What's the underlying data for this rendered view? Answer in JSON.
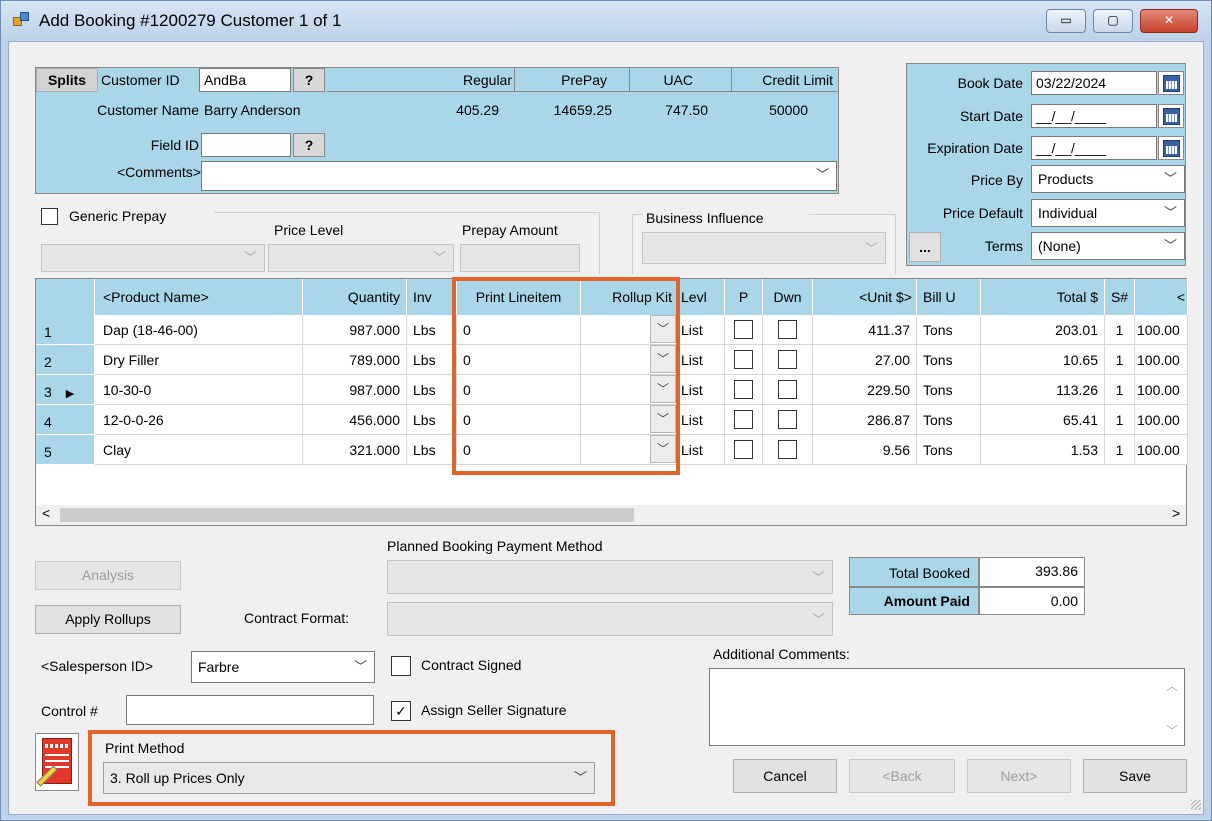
{
  "window": {
    "title": "Add Booking #1200279 Customer 1 of 1",
    "controls": {
      "minimize": "▭",
      "maximize": "▢",
      "close": "✕"
    }
  },
  "customer": {
    "splits_label": "Splits",
    "customer_id_label": "Customer ID",
    "customer_id_value": "AndBa",
    "lookup_label": "?",
    "customer_name_label": "Customer Name",
    "customer_name_value": "Barry Anderson",
    "field_id_label": "Field ID",
    "field_id_value": "",
    "comments_label": "<Comments>",
    "comments_value": "",
    "balances": [
      {
        "header": "Regular",
        "value": "405.29"
      },
      {
        "header": "PrePay",
        "value": "14659.25"
      },
      {
        "header": "UAC",
        "value": "747.50"
      },
      {
        "header": "Credit Limit",
        "value": "50000"
      }
    ]
  },
  "dates": {
    "book_date_label": "Book Date",
    "book_date_value": "03/22/2024",
    "start_date_label": "Start Date",
    "start_date_value": "__/__/____",
    "expiration_date_label": "Expiration Date",
    "expiration_date_value": "__/__/____",
    "price_by_label": "Price By",
    "price_by_value": "Products",
    "price_default_label": "Price Default",
    "price_default_value": "Individual",
    "terms_button": "...",
    "terms_label": "Terms",
    "terms_value": "(None)"
  },
  "prepay": {
    "generic_prepay_label": "Generic Prepay",
    "price_level_label": "Price Level",
    "prepay_amount_label": "Prepay Amount",
    "business_influence_label": "Business Influence"
  },
  "grid": {
    "headers": {
      "product": "<Product Name>",
      "quantity": "Quantity",
      "inv": "Inv",
      "print_lineitem": "Print Lineitem",
      "rollup_kit": "Rollup Kit",
      "levl": "Levl",
      "p": "P",
      "dwn": "Dwn",
      "unit_price": "<Unit $>",
      "bill_u": "Bill U",
      "total": "Total $",
      "s_num": "S#",
      "more": "<"
    },
    "rows": [
      {
        "num": "1",
        "product": "Dap (18-46-00)",
        "quantity": "987.000",
        "inv": "Lbs",
        "print_lineitem": "0",
        "rollup_kit": "",
        "levl": "List",
        "unit_price": "411.37",
        "bill_u": "Tons",
        "total": "203.01",
        "s_num": "1",
        "more": "100.00"
      },
      {
        "num": "2",
        "product": "Dry Filler",
        "quantity": "789.000",
        "inv": "Lbs",
        "print_lineitem": "0",
        "rollup_kit": "",
        "levl": "List",
        "unit_price": "27.00",
        "bill_u": "Tons",
        "total": "10.65",
        "s_num": "1",
        "more": "100.00"
      },
      {
        "num": "3",
        "product": "10-30-0",
        "quantity": "987.000",
        "inv": "Lbs",
        "print_lineitem": "0",
        "rollup_kit": "",
        "levl": "List",
        "unit_price": "229.50",
        "bill_u": "Tons",
        "total": "113.26",
        "s_num": "1",
        "more": "100.00"
      },
      {
        "num": "4",
        "product": "12-0-0-26",
        "quantity": "456.000",
        "inv": "Lbs",
        "print_lineitem": "0",
        "rollup_kit": "",
        "levl": "List",
        "unit_price": "286.87",
        "bill_u": "Tons",
        "total": "65.41",
        "s_num": "1",
        "more": "100.00"
      },
      {
        "num": "5",
        "product": "Clay",
        "quantity": "321.000",
        "inv": "Lbs",
        "print_lineitem": "0",
        "rollup_kit": "",
        "levl": "List",
        "unit_price": "9.56",
        "bill_u": "Tons",
        "total": "1.53",
        "s_num": "1",
        "more": "100.00"
      }
    ],
    "current_row_marker": "▶",
    "scroll_left": "<",
    "scroll_right": ">"
  },
  "bottom": {
    "analysis_button": "Analysis",
    "apply_rollups_button": "Apply Rollups",
    "planned_payment_label": "Planned Booking Payment Method",
    "contract_format_label": "Contract Format:",
    "total_booked_label": "Total Booked",
    "total_booked_value": "393.86",
    "amount_paid_label": "Amount Paid",
    "amount_paid_value": "0.00",
    "salesperson_label": "<Salesperson ID>",
    "salesperson_value": "Farbre",
    "contract_signed_label": "Contract Signed",
    "assign_seller_label": "Assign Seller Signature",
    "control_label": "Control #",
    "control_value": "",
    "additional_comments_label": "Additional Comments:",
    "print_method_label": "Print Method",
    "print_method_value": "3. Roll up Prices Only",
    "cancel_button": "Cancel",
    "back_button": "<Back",
    "next_button": "Next>",
    "save_button": "Save"
  },
  "colors": {
    "highlight": "#e2642b",
    "header_blue": "#aad6ea"
  }
}
